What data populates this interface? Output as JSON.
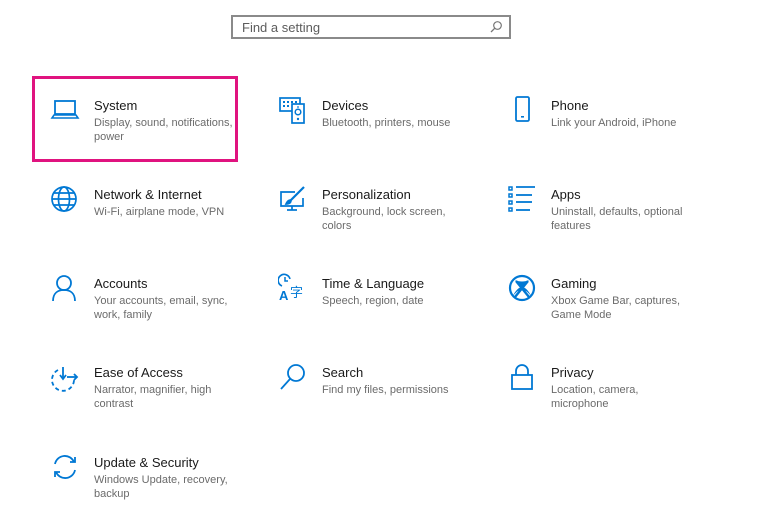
{
  "search": {
    "placeholder": "Find a setting",
    "value": ""
  },
  "colors": {
    "accent": "#0078d4",
    "selection_outline": "#e0137f"
  },
  "selected_tile": "system",
  "tiles": [
    {
      "id": "system",
      "icon": "laptop-icon",
      "title": "System",
      "desc": "Display, sound, notifications, power"
    },
    {
      "id": "devices",
      "icon": "devices-icon",
      "title": "Devices",
      "desc": "Bluetooth, printers, mouse"
    },
    {
      "id": "phone",
      "icon": "phone-icon",
      "title": "Phone",
      "desc": "Link your Android, iPhone"
    },
    {
      "id": "network",
      "icon": "globe-icon",
      "title": "Network & Internet",
      "desc": "Wi-Fi, airplane mode, VPN"
    },
    {
      "id": "personalization",
      "icon": "paintbrush-monitor-icon",
      "title": "Personalization",
      "desc": "Background, lock screen, colors"
    },
    {
      "id": "apps",
      "icon": "apps-list-icon",
      "title": "Apps",
      "desc": "Uninstall, defaults, optional features"
    },
    {
      "id": "accounts",
      "icon": "person-icon",
      "title": "Accounts",
      "desc": "Your accounts, email, sync, work, family"
    },
    {
      "id": "time-language",
      "icon": "time-language-icon",
      "title": "Time & Language",
      "desc": "Speech, region, date"
    },
    {
      "id": "gaming",
      "icon": "xbox-icon",
      "title": "Gaming",
      "desc": "Xbox Game Bar, captures, Game Mode"
    },
    {
      "id": "ease-of-access",
      "icon": "ease-of-access-icon",
      "title": "Ease of Access",
      "desc": "Narrator, magnifier, high contrast"
    },
    {
      "id": "search",
      "icon": "magnifier-icon",
      "title": "Search",
      "desc": "Find my files, permissions"
    },
    {
      "id": "privacy",
      "icon": "lock-icon",
      "title": "Privacy",
      "desc": "Location, camera, microphone"
    },
    {
      "id": "update-security",
      "icon": "sync-arrows-icon",
      "title": "Update & Security",
      "desc": "Windows Update, recovery, backup"
    }
  ]
}
